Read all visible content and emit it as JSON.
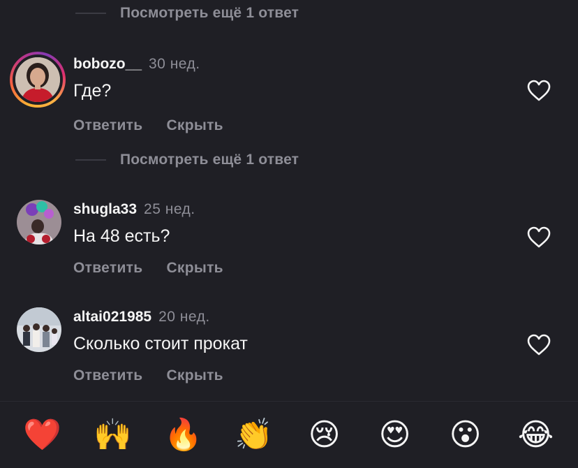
{
  "view_more": [
    {
      "label": "Посмотреть ещё 1 ответ"
    },
    {
      "label": "Посмотреть ещё 1 ответ"
    }
  ],
  "comments": [
    {
      "username": "bobozo__",
      "time": "30 нед.",
      "text": "Где?",
      "reply": "Ответить",
      "hide": "Скрыть",
      "avatar": "avatar-woman-red",
      "has_story": true
    },
    {
      "username": "shugla33",
      "time": "25 нед.",
      "text": "На 48 есть?",
      "reply": "Ответить",
      "hide": "Скрыть",
      "avatar": "avatar-balloons",
      "has_story": false
    },
    {
      "username": "altai021985",
      "time": "20 нед.",
      "text": "Сколько стоит прокат",
      "reply": "Ответить",
      "hide": "Скрыть",
      "avatar": "avatar-family",
      "has_story": false
    }
  ],
  "reactions": [
    {
      "name": "red-heart",
      "glyph": "❤️"
    },
    {
      "name": "raising-hands",
      "glyph": "🙌"
    },
    {
      "name": "fire",
      "glyph": "🔥"
    },
    {
      "name": "clapping-hands",
      "glyph": "👏"
    },
    {
      "name": "crying-face",
      "glyph": "😢"
    },
    {
      "name": "heart-eyes",
      "glyph": "😍"
    },
    {
      "name": "surprised-face",
      "glyph": "😮"
    },
    {
      "name": "tears-of-joy",
      "glyph": "😂"
    }
  ],
  "colors": {
    "background": "#1f1f25",
    "text": "#f5f5f5",
    "muted": "#8e8e97"
  },
  "icons": {
    "like": "heart-outline-icon"
  }
}
